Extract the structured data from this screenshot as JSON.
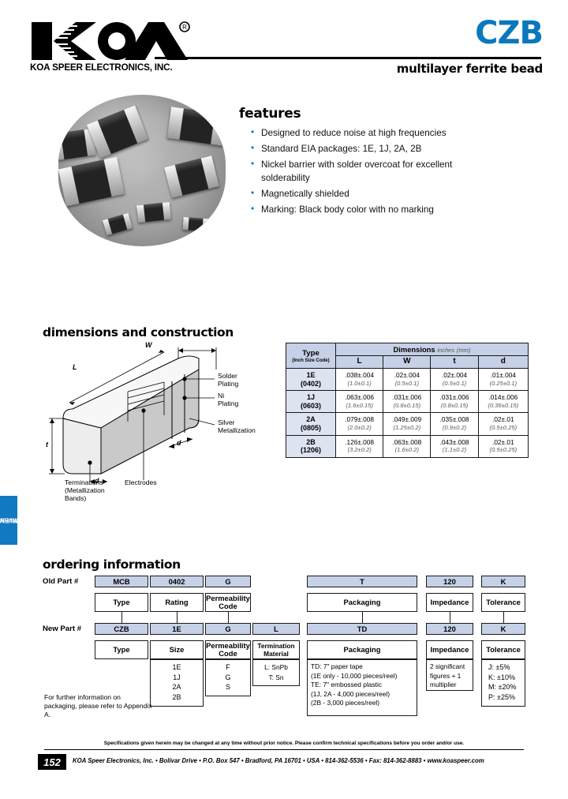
{
  "header": {
    "company": "KOA SPEER ELECTRONICS, INC.",
    "product_code": "CZB",
    "subtitle": "multilayer ferrite bead",
    "registered_mark": "®",
    "accent_blue": "#0b78bd"
  },
  "features": {
    "title": "features",
    "items": [
      "Designed to reduce noise at high frequencies",
      "Standard EIA packages: 1E, 1J, 2A, 2B",
      "Nickel barrier with solder overcoat for excellent",
      "Magnetically shielded",
      "Marking: Black body color with no marking"
    ],
    "item3_continuation": "solderability"
  },
  "dimensions": {
    "title": "dimensions and construction",
    "diagram_labels": {
      "solder_plating": "Solder\nPlating",
      "ni_plating": "Ni\nPlating",
      "silver_metallization": "Silver\nMetallization",
      "terminations": "Terminations\n(Metallization\nBands)",
      "electrodes": "Electrodes",
      "dim_L": "L",
      "dim_W": "W",
      "dim_t": "t",
      "dim_d_left": "d",
      "dim_d_right": "d"
    },
    "table": {
      "header_type": "Type",
      "header_type_sub": "(Inch Size Code)",
      "header_dimensions": "Dimensions",
      "header_dimensions_unit_inches": "inches",
      "header_dimensions_unit_mm": "(mm)",
      "columns": [
        "L",
        "W",
        "t",
        "d"
      ],
      "rows": [
        {
          "type": "1E",
          "code": "(0402)",
          "L_in": ".038±.004",
          "L_mm": "(1.0±0.1)",
          "W_in": ".02±.004",
          "W_mm": "(0.5±0.1)",
          "t_in": ".02±.004",
          "t_mm": "(0.5±0.1)",
          "d_in": ".01±.004",
          "d_mm": "(0.25±0.1)"
        },
        {
          "type": "1J",
          "code": "(0603)",
          "L_in": ".063±.006",
          "L_mm": "(1.6±0.15)",
          "W_in": ".031±.006",
          "W_mm": "(0.8±0.15)",
          "t_in": ".031±.006",
          "t_mm": "(0.8±0.15)",
          "d_in": ".014±.006",
          "d_mm": "(0.36±0.15)"
        },
        {
          "type": "2A",
          "code": "(0805)",
          "L_in": ".079±.008",
          "L_mm": "(2.0±0.2)",
          "W_in": ".049±.009",
          "W_mm": "(1.25±0.2)",
          "t_in": ".035±.008",
          "t_mm": "(0.9±0.2)",
          "d_in": ".02±.01",
          "d_mm": "(0.5±0.25)"
        },
        {
          "type": "2B",
          "code": "(1206)",
          "L_in": ".126±.008",
          "L_mm": "(3.2±0.2)",
          "W_in": ".063±.008",
          "W_mm": "(1.6±0.2)",
          "t_in": ".043±.008",
          "t_mm": "(1.1±0.2)",
          "d_in": ".02±.01",
          "d_mm": "(0.5±0.25)"
        }
      ]
    }
  },
  "side_tab": {
    "line1": "EMI/EMC",
    "line2": "filtering"
  },
  "ordering": {
    "title": "ordering information",
    "old_label": "Old Part #",
    "new_label": "New Part #",
    "old": {
      "type_code": "MCB",
      "type_name": "Type",
      "rating_code": "0402",
      "rating_name": "Rating",
      "perm_code": "G",
      "perm_name": "Permeability\nCode",
      "packaging_code": "T",
      "packaging_name": "Packaging",
      "impedance_code": "120",
      "impedance_name": "Impedance",
      "tolerance_code": "K",
      "tolerance_name": "Tolerance"
    },
    "new": {
      "type_code": "CZB",
      "type_name": "Type",
      "size_code": "1E",
      "size_name": "Size",
      "sizes": [
        "1E",
        "1J",
        "2A",
        "2B"
      ],
      "perm_code": "G",
      "perm_name": "Permeability\nCode",
      "perm_values": [
        "F",
        "G",
        "S"
      ],
      "term_code": "L",
      "term_name": "Termination\nMaterial",
      "term_values": [
        "L: SnPb",
        "T: Sn"
      ],
      "packaging_code": "TD",
      "packaging_name": "Packaging",
      "packaging_detail": "TD: 7\" paper tape\n(1E only - 10,000 pieces/reel)\nTE: 7\" embossed plastic\n(1J, 2A - 4,000 pieces/reel)\n(2B - 3,000 pieces/reel)",
      "impedance_code": "120",
      "impedance_name": "Impedance",
      "impedance_detail": "2 significant\nfigures + 1\nmultiplier",
      "tolerance_code": "K",
      "tolerance_name": "Tolerance",
      "tolerance_values": [
        "J: ±5%",
        "K: ±10%",
        "M: ±20%",
        "P: ±25%"
      ]
    },
    "appendix_note": "For further information on packaging, please refer to Appendix A."
  },
  "footer": {
    "spec_note": "Specifications given herein may be changed at any time without prior notice. Please confirm technical specifications before you order and/or use.",
    "page_number": "152",
    "address": "KOA Speer Electronics, Inc. • Bolivar Drive • P.O. Box 547 • Bradford, PA 16701 • USA • 814-362-5536 • Fax: 814-362-8883 • www.koaspeer.com"
  }
}
